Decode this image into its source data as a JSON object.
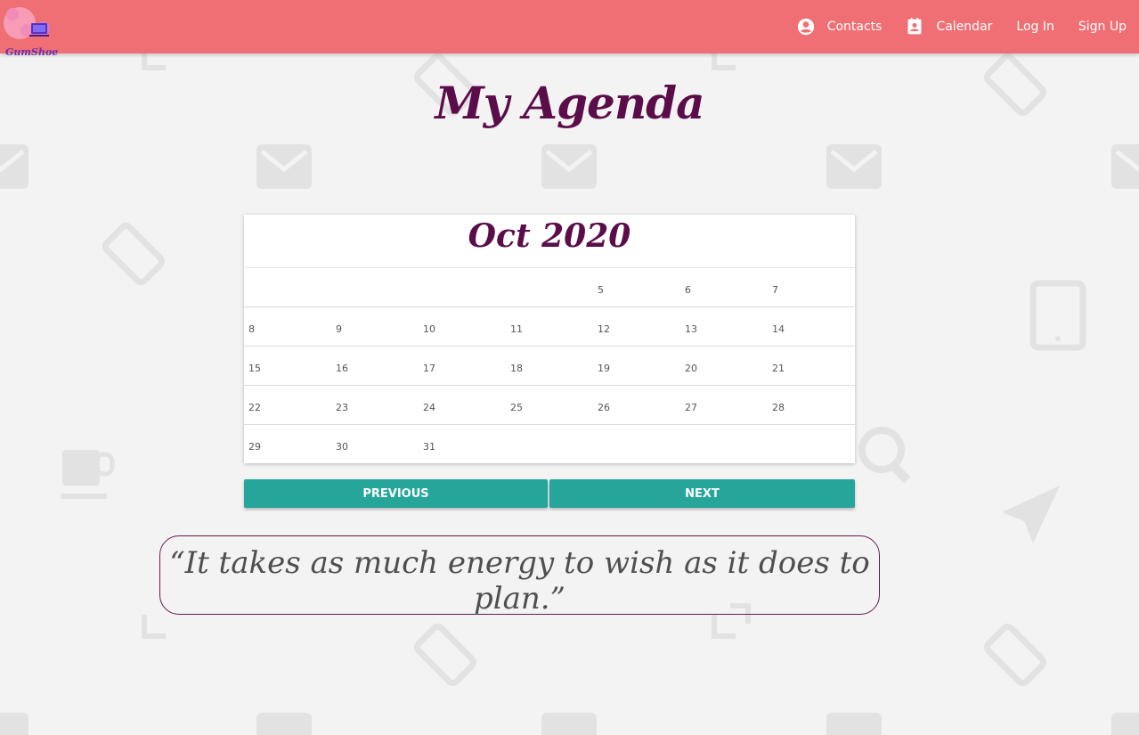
{
  "header": {
    "logo_text": "GumShoe",
    "nav": [
      {
        "label": "Contacts",
        "icon": "account-circle-icon"
      },
      {
        "label": "Calendar",
        "icon": "contact-card-icon"
      },
      {
        "label": "Log In"
      },
      {
        "label": "Sign Up"
      }
    ]
  },
  "page": {
    "title": "My Agenda"
  },
  "calendar": {
    "month_title": "Oct 2020",
    "weeks": [
      [
        "",
        "",
        "",
        "",
        "5",
        "6",
        "7"
      ],
      [
        "8",
        "9",
        "10",
        "11",
        "12",
        "13",
        "14"
      ],
      [
        "15",
        "16",
        "17",
        "18",
        "19",
        "20",
        "21"
      ],
      [
        "22",
        "23",
        "24",
        "25",
        "26",
        "27",
        "28"
      ],
      [
        "29",
        "30",
        "31",
        "",
        "",
        "",
        ""
      ]
    ]
  },
  "buttons": {
    "previous": "PREVIOUS",
    "next": "NEXT"
  },
  "quote": {
    "text": "“It takes as much energy to wish as it does to plan.”"
  },
  "colors": {
    "navbar": "#ef6f74",
    "title": "#5b0d4a",
    "button": "#26a69a",
    "background": "#f3f3f3"
  }
}
